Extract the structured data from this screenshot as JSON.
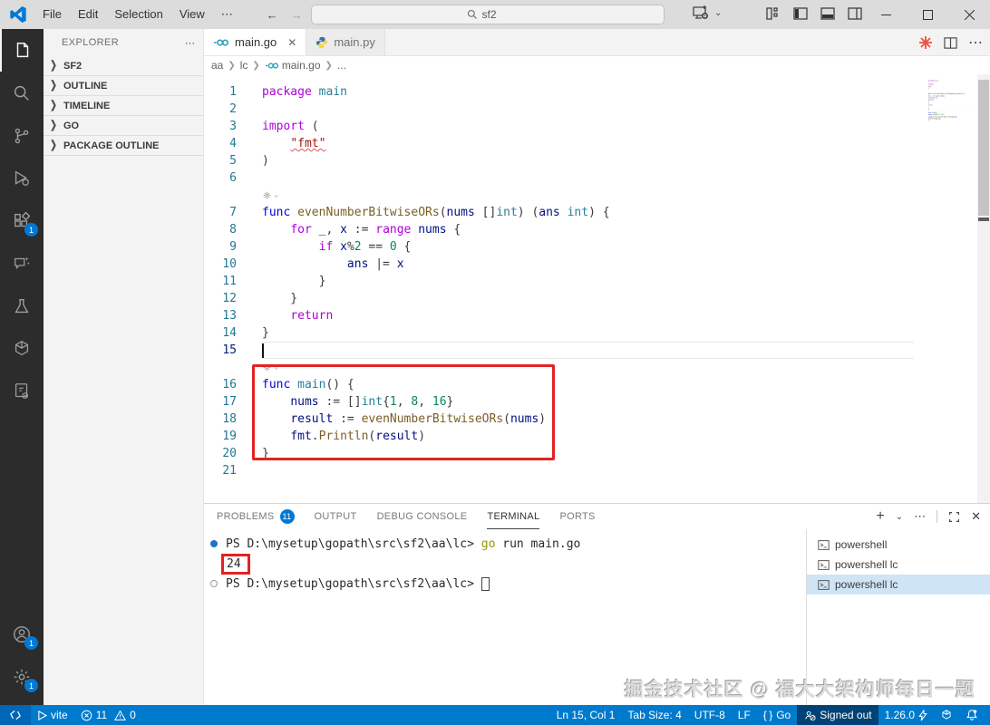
{
  "titlebar": {
    "menus": [
      "File",
      "Edit",
      "Selection",
      "View"
    ],
    "menu_more": "⋯",
    "search_value": "sf2"
  },
  "activity_bar": {
    "items": [
      {
        "name": "explorer",
        "badge": ""
      },
      {
        "name": "search",
        "badge": ""
      },
      {
        "name": "source-control",
        "badge": ""
      },
      {
        "name": "run-debug",
        "badge": ""
      },
      {
        "name": "extensions",
        "badge": "1"
      },
      {
        "name": "chat",
        "badge": ""
      },
      {
        "name": "testing",
        "badge": ""
      },
      {
        "name": "docker",
        "badge": ""
      },
      {
        "name": "notebooks",
        "badge": ""
      }
    ],
    "account_badge": "1",
    "settings_badge": "1"
  },
  "sidebar": {
    "title": "EXPLORER",
    "more": "⋯",
    "sections": [
      "SF2",
      "OUTLINE",
      "TIMELINE",
      "GO",
      "PACKAGE OUTLINE"
    ]
  },
  "tabs": [
    {
      "label": "main.go"
    },
    {
      "label": "main.py"
    }
  ],
  "breadcrumb": {
    "crumbs": [
      "aa",
      "lc",
      "main.go",
      "..."
    ]
  },
  "editor": {
    "cursor_line": 15,
    "rows": [
      {
        "n": 1,
        "t": [
          [
            "k",
            "package"
          ],
          [
            "p",
            " "
          ],
          [
            "ty",
            "main"
          ]
        ]
      },
      {
        "n": 2,
        "t": []
      },
      {
        "n": 3,
        "t": [
          [
            "k",
            "import"
          ],
          [
            "p",
            " ("
          ]
        ]
      },
      {
        "n": 4,
        "t": [
          [
            "p",
            "    "
          ],
          [
            "stru",
            "\"fmt\""
          ]
        ]
      },
      {
        "n": 5,
        "t": [
          [
            "p",
            ")"
          ]
        ]
      },
      {
        "n": 6,
        "t": []
      },
      {
        "lens": true
      },
      {
        "n": 7,
        "t": [
          [
            "kb",
            "func"
          ],
          [
            "p",
            " "
          ],
          [
            "fn",
            "evenNumberBitwiseORs"
          ],
          [
            "p",
            "("
          ],
          [
            "v",
            "nums"
          ],
          [
            "p",
            " []"
          ],
          [
            "ty",
            "int"
          ],
          [
            "p",
            ") ("
          ],
          [
            "v",
            "ans"
          ],
          [
            "p",
            " "
          ],
          [
            "ty",
            "int"
          ],
          [
            "p",
            ") {"
          ]
        ]
      },
      {
        "n": 8,
        "t": [
          [
            "p",
            "    "
          ],
          [
            "k",
            "for"
          ],
          [
            "p",
            " "
          ],
          [
            "v",
            "_"
          ],
          [
            "p",
            ", "
          ],
          [
            "v",
            "x"
          ],
          [
            "p",
            " := "
          ],
          [
            "k",
            "range"
          ],
          [
            "p",
            " "
          ],
          [
            "v",
            "nums"
          ],
          [
            "p",
            " {"
          ]
        ]
      },
      {
        "n": 9,
        "t": [
          [
            "p",
            "        "
          ],
          [
            "k",
            "if"
          ],
          [
            "p",
            " "
          ],
          [
            "v",
            "x"
          ],
          [
            "p",
            "%"
          ],
          [
            "n2",
            "2"
          ],
          [
            "p",
            " == "
          ],
          [
            "n2",
            "0"
          ],
          [
            "p",
            " {"
          ]
        ]
      },
      {
        "n": 10,
        "t": [
          [
            "p",
            "            "
          ],
          [
            "v",
            "ans"
          ],
          [
            "p",
            " |= "
          ],
          [
            "v",
            "x"
          ]
        ]
      },
      {
        "n": 11,
        "t": [
          [
            "p",
            "        }"
          ]
        ]
      },
      {
        "n": 12,
        "t": [
          [
            "p",
            "    }"
          ]
        ]
      },
      {
        "n": 13,
        "t": [
          [
            "p",
            "    "
          ],
          [
            "k",
            "return"
          ]
        ]
      },
      {
        "n": 14,
        "t": [
          [
            "p",
            "}"
          ]
        ]
      },
      {
        "n": 15,
        "t": []
      },
      {
        "lens": true
      },
      {
        "n": 16,
        "t": [
          [
            "kb",
            "func"
          ],
          [
            "p",
            " "
          ],
          [
            "ty",
            "main"
          ],
          [
            "p",
            "() {"
          ]
        ]
      },
      {
        "n": 17,
        "t": [
          [
            "p",
            "    "
          ],
          [
            "v",
            "nums"
          ],
          [
            "p",
            " := []"
          ],
          [
            "ty",
            "int"
          ],
          [
            "p",
            "{"
          ],
          [
            "n2",
            "1"
          ],
          [
            "p",
            ", "
          ],
          [
            "n2",
            "8"
          ],
          [
            "p",
            ", "
          ],
          [
            "n2",
            "16"
          ],
          [
            "p",
            "}"
          ]
        ]
      },
      {
        "n": 18,
        "t": [
          [
            "p",
            "    "
          ],
          [
            "v",
            "result"
          ],
          [
            "p",
            " := "
          ],
          [
            "fn",
            "evenNumberBitwiseORs"
          ],
          [
            "p",
            "("
          ],
          [
            "v",
            "nums"
          ],
          [
            "p",
            ")"
          ]
        ]
      },
      {
        "n": 19,
        "t": [
          [
            "p",
            "    "
          ],
          [
            "v",
            "fmt"
          ],
          [
            "p",
            "."
          ],
          [
            "fn",
            "Println"
          ],
          [
            "p",
            "("
          ],
          [
            "v",
            "result"
          ],
          [
            "p",
            ")"
          ]
        ]
      },
      {
        "n": 20,
        "t": [
          [
            "p",
            "}"
          ]
        ]
      },
      {
        "n": 21,
        "t": []
      }
    ]
  },
  "panel": {
    "tabs": [
      {
        "label": "PROBLEMS",
        "badge": "11",
        "active": false
      },
      {
        "label": "OUTPUT",
        "badge": "",
        "active": false
      },
      {
        "label": "DEBUG CONSOLE",
        "badge": "",
        "active": false
      },
      {
        "label": "TERMINAL",
        "badge": "",
        "active": true
      },
      {
        "label": "PORTS",
        "badge": "",
        "active": false
      }
    ],
    "terminal_lines": [
      {
        "deco": "filled",
        "segments": [
          [
            "plain",
            "PS D:\\mysetup\\gopath\\src\\sf2\\aa\\lc> "
          ],
          [
            "cmd",
            "go"
          ],
          [
            "plain",
            " run main.go"
          ]
        ]
      },
      {
        "deco": "",
        "boxed": "24",
        "segments": []
      },
      {
        "deco": "empty",
        "cursor": true,
        "segments": [
          [
            "plain",
            "PS D:\\mysetup\\gopath\\src\\sf2\\aa\\lc> "
          ]
        ]
      }
    ],
    "terminal_list": [
      {
        "label": "powershell",
        "selected": false
      },
      {
        "label": "powershell lc",
        "selected": false
      },
      {
        "label": "powershell lc",
        "selected": true
      }
    ]
  },
  "status_bar": {
    "vite": "vite",
    "errors": "11",
    "warnings": "0",
    "ln_col": "Ln 15, Col 1",
    "tab_size": "Tab Size: 4",
    "encoding": "UTF-8",
    "eol": "LF",
    "lang_icon": "{ }",
    "lang": "Go",
    "signed_out": "Signed out",
    "version": "1.26.0"
  },
  "watermark": "掘金技术社区 @ 福大大架构师每日一题",
  "colors": {
    "accent": "#007acc",
    "badge": "#0078d4",
    "highlight_red": "#e42222",
    "error_squiggle": "#e45454"
  }
}
